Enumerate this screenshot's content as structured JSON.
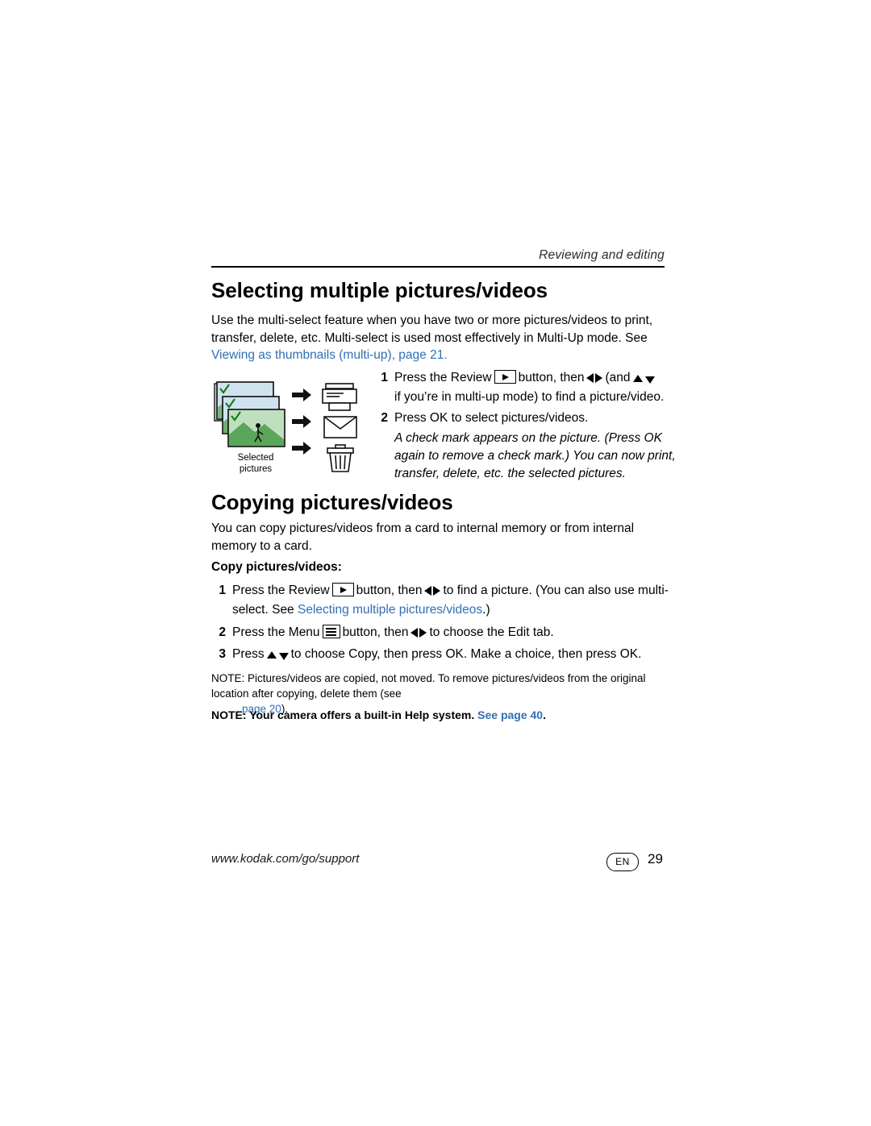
{
  "header": {
    "title": "Reviewing and editing"
  },
  "sections": {
    "selecting": {
      "heading": "Selecting multiple pictures/videos",
      "intro": "Use the multi-select feature when you have two or more pictures/videos to print, transfer, delete, etc. Multi-select is used most effectively in Multi-Up mode. See",
      "link": "Viewing as thumbnails (multi-up), page",
      "link_page": "21",
      "link_suffix": ".",
      "steps": [
        {
          "num": "1",
          "before_icon": "Press the Review",
          "after_icon": "button, then",
          "mid": "(and",
          "tail": "if you’re in multi-up mode) to find a picture/video."
        },
        {
          "num": "2",
          "text": "Press OK to select pictures/videos."
        }
      ],
      "italic_note": "A check mark appears on the picture. (Press OK again to remove a check mark.) You can now print, transfer, delete, etc. the selected pictures.",
      "illustration_caption": "Selected pictures"
    },
    "copying": {
      "heading": "Copying pictures/videos",
      "intro": "You can copy pictures/videos from a card to internal memory or from internal memory to a card.",
      "subheading": "Copy pictures/videos:",
      "steps": [
        {
          "num": "1",
          "before_icon": "Press the Review",
          "after_icon": "button, then",
          "tail": "to find a picture. (You can also use multi-select. See",
          "link": "Selecting multiple pictures/videos",
          "tail2": ".)"
        },
        {
          "num": "2",
          "before_icon": "Press the Menu",
          "after_icon": "button, then",
          "tail": "to choose the Edit tab."
        },
        {
          "num": "3",
          "before_icon": "Press",
          "tail": "to choose Copy, then press OK. Make a choice, then press OK."
        }
      ],
      "notes": [
        {
          "label": "NOTE:",
          "text": "Pictures/videos are copied, not moved. To remove pictures/videos from the original location after copying, delete them (see",
          "link": "page 20",
          "tail": ")."
        },
        {
          "label": "NOTE:",
          "text": "Your camera offers a built-in Help system.",
          "link": "See page 40",
          "tail": "."
        }
      ]
    }
  },
  "footer": {
    "url": "www.kodak.com/go/support",
    "lang": "EN",
    "page_number": "29"
  },
  "colors": {
    "link": "#2f6fb5",
    "text": "#000000"
  }
}
